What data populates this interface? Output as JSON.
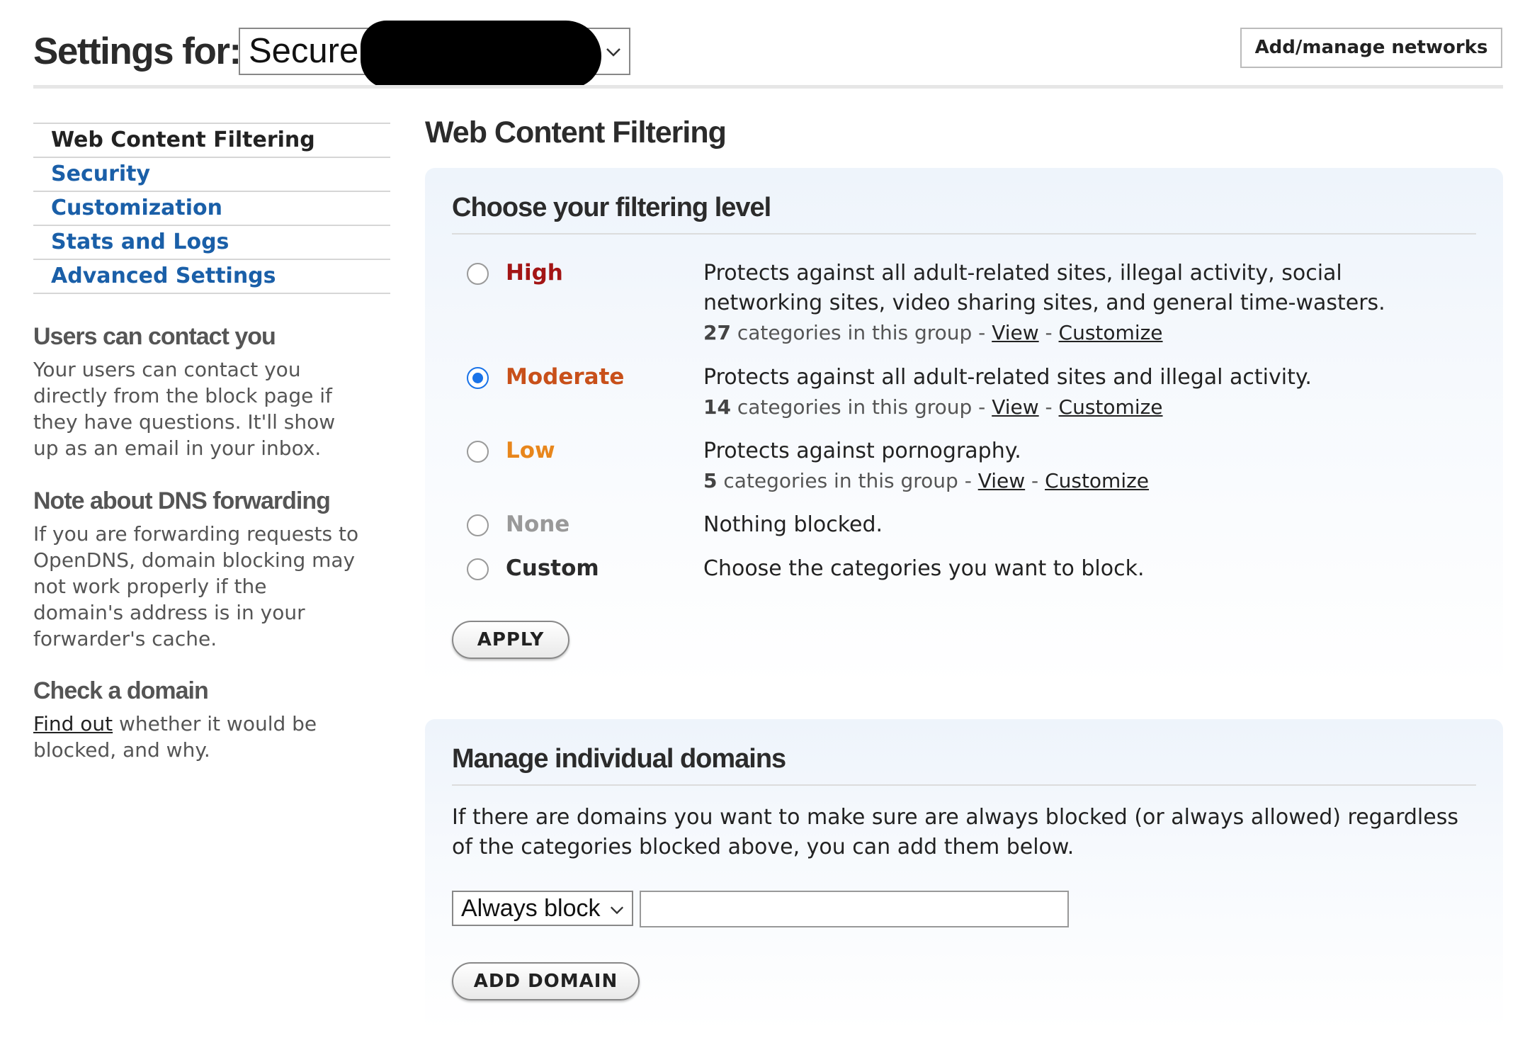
{
  "header": {
    "title": "Settings for:",
    "network_value": "Secure",
    "add_manage_label": "Add/manage networks"
  },
  "sidebar": {
    "items": [
      {
        "label": "Web Content Filtering",
        "active": true
      },
      {
        "label": "Security",
        "active": false
      },
      {
        "label": "Customization",
        "active": false
      },
      {
        "label": "Stats and Logs",
        "active": false
      },
      {
        "label": "Advanced Settings",
        "active": false
      }
    ],
    "contact": {
      "heading": "Users can contact you",
      "text": "Your users can contact you directly from the block page if they have questions. It'll show up as an email in your inbox."
    },
    "dns_note": {
      "heading": "Note about DNS forwarding",
      "text": "If you are forwarding requests to OpenDNS, domain blocking may not work properly if the domain's address is in your forwarder's cache."
    },
    "check_domain": {
      "heading": "Check a domain",
      "link": "Find out",
      "text": " whether it would be blocked, and why."
    }
  },
  "main": {
    "title": "Web Content Filtering",
    "filtering": {
      "heading": "Choose your filtering level",
      "levels": [
        {
          "label": "High",
          "color": "#a31515",
          "checked": false,
          "desc1": "Protects against all adult-related sites, illegal activity, social",
          "desc2": "networking sites, video sharing sites, and general time-wasters.",
          "count": "27",
          "cats_text": " categories in this group - ",
          "view": "View",
          "sep": " - ",
          "customize": "Customize"
        },
        {
          "label": "Moderate",
          "color": "#c8501a",
          "checked": true,
          "desc1": "Protects against all adult-related sites and illegal activity.",
          "count": "14",
          "cats_text": " categories in this group - ",
          "view": "View",
          "sep": " - ",
          "customize": "Customize"
        },
        {
          "label": "Low",
          "color": "#e8861c",
          "checked": false,
          "desc1": "Protects against pornography.",
          "count": "5",
          "cats_text": " categories in this group - ",
          "view": "View",
          "sep": " - ",
          "customize": "Customize"
        },
        {
          "label": "None",
          "color": "#999999",
          "checked": false,
          "desc1": "Nothing blocked."
        },
        {
          "label": "Custom",
          "color": "#2b2b2b",
          "checked": false,
          "desc1": "Choose the categories you want to block."
        }
      ],
      "apply_label": "APPLY"
    },
    "domains": {
      "heading": "Manage individual domains",
      "text1": "If there are domains you want to make sure are always blocked (or always allowed) regardless",
      "text2": "of the categories blocked above, you can add them below.",
      "mode_value": "Always block",
      "domain_value": "",
      "add_label": "ADD DOMAIN"
    }
  }
}
